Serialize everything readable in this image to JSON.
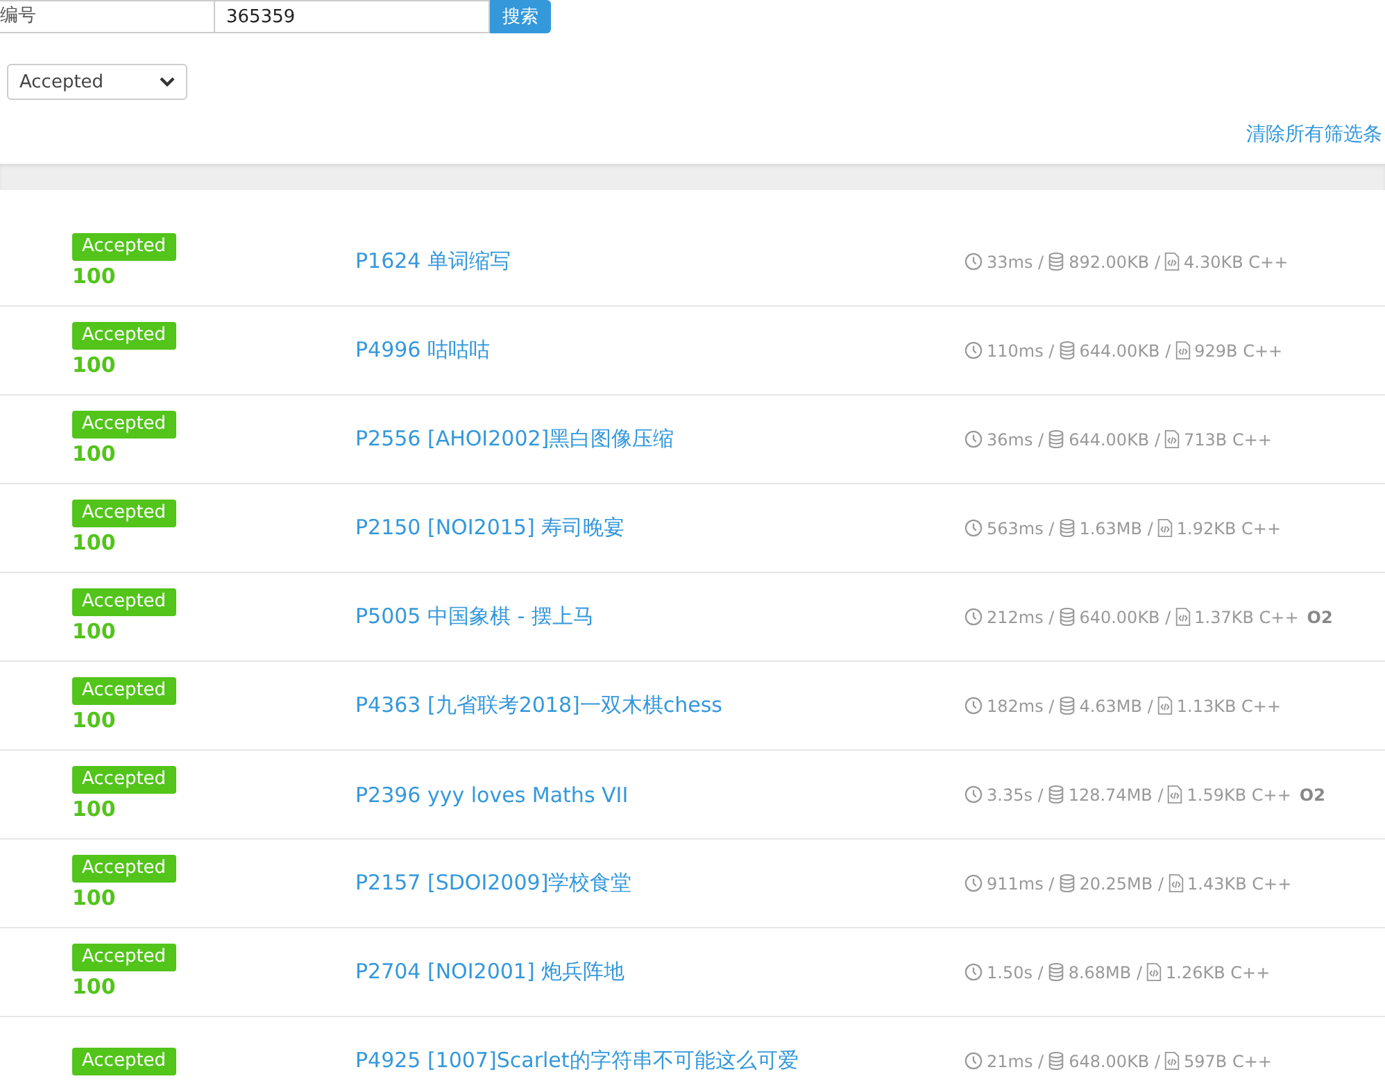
{
  "search": {
    "label": "编号",
    "value": "365359",
    "button": "搜索"
  },
  "status_filter": {
    "value": "Accepted"
  },
  "clear_filters": "清除所有筛选条",
  "records": [
    {
      "status": "Accepted",
      "score": "100",
      "problem": "P1624 单词缩写",
      "time": "33ms /",
      "memory": "892.00KB /",
      "code_size": "4.30KB C++"
    },
    {
      "status": "Accepted",
      "score": "100",
      "problem": "P4996 咕咕咕",
      "time": "110ms /",
      "memory": "644.00KB /",
      "code_size": "929B C++"
    },
    {
      "status": "Accepted",
      "score": "100",
      "problem": "P2556 [AHOI2002]黑白图像压缩",
      "time": "36ms /",
      "memory": "644.00KB /",
      "code_size": "713B C++"
    },
    {
      "status": "Accepted",
      "score": "100",
      "problem": "P2150 [NOI2015] 寿司晚宴",
      "time": "563ms /",
      "memory": "1.63MB /",
      "code_size": "1.92KB C++"
    },
    {
      "status": "Accepted",
      "score": "100",
      "problem": "P5005 中国象棋 - 摆上马",
      "time": "212ms /",
      "memory": "640.00KB /",
      "code_size": "1.37KB C++",
      "optimization": "O2"
    },
    {
      "status": "Accepted",
      "score": "100",
      "problem": "P4363 [九省联考2018]一双木棋chess",
      "time": "182ms /",
      "memory": "4.63MB /",
      "code_size": "1.13KB C++"
    },
    {
      "status": "Accepted",
      "score": "100",
      "problem": "P2396 yyy loves Maths VII",
      "time": "3.35s /",
      "memory": "128.74MB /",
      "code_size": "1.59KB C++",
      "optimization": "O2"
    },
    {
      "status": "Accepted",
      "score": "100",
      "problem": "P2157 [SDOI2009]学校食堂",
      "time": "911ms /",
      "memory": "20.25MB /",
      "code_size": "1.43KB C++"
    },
    {
      "status": "Accepted",
      "score": "100",
      "problem": "P2704 [NOI2001] 炮兵阵地",
      "time": "1.50s /",
      "memory": "8.68MB /",
      "code_size": "1.26KB C++"
    },
    {
      "status": "Accepted",
      "problem": "P4925 [1007]Scarlet的字符串不可能这么可爱",
      "time": "21ms /",
      "memory": "648.00KB /",
      "code_size": "597B C++"
    }
  ]
}
